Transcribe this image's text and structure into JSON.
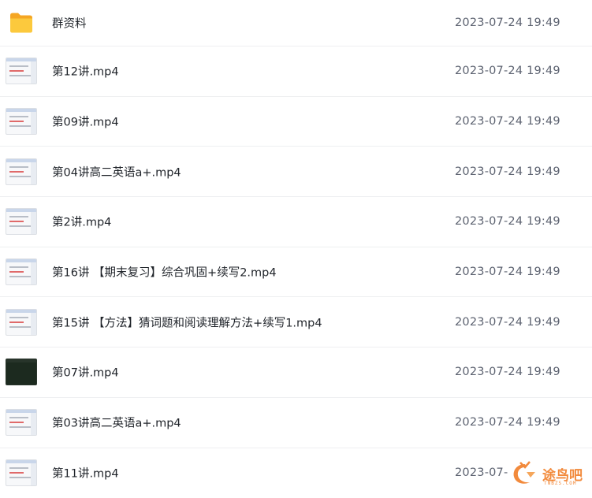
{
  "files": [
    {
      "name": "群资料",
      "date": "2023-07-24 19:49",
      "type": "folder"
    },
    {
      "name": "第12讲.mp4",
      "date": "2023-07-24 19:49",
      "type": "video"
    },
    {
      "name": "第09讲.mp4",
      "date": "2023-07-24 19:49",
      "type": "video"
    },
    {
      "name": "第04讲高二英语a+.mp4",
      "date": "2023-07-24 19:49",
      "type": "video"
    },
    {
      "name": "第2讲.mp4",
      "date": "2023-07-24 19:49",
      "type": "video"
    },
    {
      "name": "第16讲 【期末复习】综合巩固+续写2.mp4",
      "date": "2023-07-24 19:49",
      "type": "video"
    },
    {
      "name": "第15讲 【方法】猜词题和阅读理解方法+续写1.mp4",
      "date": "2023-07-24 19:49",
      "type": "video"
    },
    {
      "name": "第07讲.mp4",
      "date": "2023-07-24 19:49",
      "type": "video-dark"
    },
    {
      "name": "第03讲高二英语a+.mp4",
      "date": "2023-07-24 19:49",
      "type": "video"
    },
    {
      "name": "第11讲.mp4",
      "date": "2023-07-",
      "type": "video"
    }
  ],
  "watermark": {
    "text": "途鸟吧",
    "sub": "TNBZS.COM"
  },
  "colors": {
    "folder": "#f7b52a",
    "accent": "#f28a3c"
  }
}
